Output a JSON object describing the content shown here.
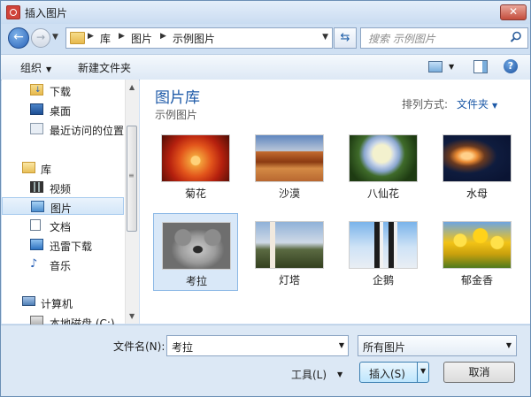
{
  "window": {
    "title": "插入图片",
    "close_label": "✕"
  },
  "address_bar": {
    "breadcrumb": [
      "库",
      "图片",
      "示例图片"
    ],
    "search_placeholder": "搜索 示例图片"
  },
  "toolbar": {
    "organize_label": "组织",
    "new_folder_label": "新建文件夹"
  },
  "nav_pane": {
    "items": [
      {
        "label": "下载",
        "icon": "downloads-folder-icon",
        "selected": false
      },
      {
        "label": "桌面",
        "icon": "desktop-icon",
        "selected": false
      },
      {
        "label": "最近访问的位置",
        "icon": "recent-places-icon",
        "selected": false
      },
      {
        "label": "库",
        "icon": "libraries-icon",
        "selected": false
      },
      {
        "label": "视频",
        "icon": "videos-library-icon",
        "selected": false
      },
      {
        "label": "图片",
        "icon": "pictures-library-icon",
        "selected": true
      },
      {
        "label": "文档",
        "icon": "documents-library-icon",
        "selected": false
      },
      {
        "label": "迅雷下载",
        "icon": "thunder-download-icon",
        "selected": false
      },
      {
        "label": "音乐",
        "icon": "music-library-icon",
        "selected": false
      },
      {
        "label": "计算机",
        "icon": "computer-icon",
        "selected": false
      },
      {
        "label": "本地磁盘 (C:)",
        "icon": "local-disk-icon",
        "selected": false
      }
    ]
  },
  "content": {
    "library_title": "图片库",
    "library_subtitle": "示例图片",
    "arrange_label": "排列方式:",
    "arrange_value": "文件夹",
    "files": [
      {
        "name": "菊花",
        "image": "chrysanthemum-photo",
        "selected": false
      },
      {
        "name": "沙漠",
        "image": "desert-photo",
        "selected": false
      },
      {
        "name": "八仙花",
        "image": "hydrangeas-photo",
        "selected": false
      },
      {
        "name": "水母",
        "image": "jellyfish-photo",
        "selected": false
      },
      {
        "name": "考拉",
        "image": "koala-photo",
        "selected": true
      },
      {
        "name": "灯塔",
        "image": "lighthouse-photo",
        "selected": false
      },
      {
        "name": "企鹅",
        "image": "penguins-photo",
        "selected": false
      },
      {
        "name": "郁金香",
        "image": "tulips-photo",
        "selected": false
      }
    ]
  },
  "footer": {
    "filename_label": "文件名(N):",
    "filename_value": "考拉",
    "filter_value": "所有图片",
    "tools_label": "工具(L)",
    "insert_label": "插入(S)",
    "cancel_label": "取消"
  },
  "colors": {
    "accent": "#1e5aa8",
    "frame": "#cfe0f3",
    "selection": "#d9e8f8"
  }
}
